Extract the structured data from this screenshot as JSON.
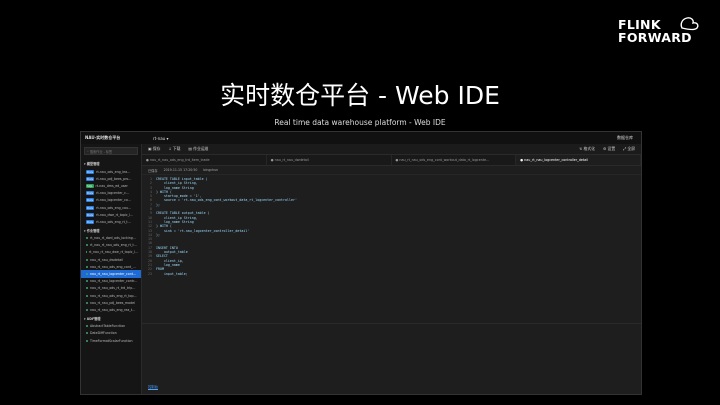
{
  "logo": {
    "line1": "FLINK",
    "line2": "FORWARD"
  },
  "title": "实时数仓平台 - Web IDE",
  "subtitle": "Real time data warehouse platform - Web IDE",
  "ide": {
    "app_name": "NAU-实时数仓平台",
    "project": "rt-nau ▾",
    "user": "数据仓库",
    "search_placeholder": "搜索作业 - 标签",
    "sections": [
      {
        "label": "▾ 模型管理",
        "items": [
          {
            "badge": "DAG",
            "label": "rt-nau_ods_eng_lea...",
            "type": "b-blue",
            "active": false
          },
          {
            "badge": "DAG",
            "label": "rt-nau_pdj_bees_pro...",
            "type": "b-blue",
            "active": false
          },
          {
            "badge": "SQL",
            "label": "rt-nau_dms_ed_user",
            "type": "b-green",
            "active": false
          },
          {
            "badge": "DAG",
            "label": "rt-nau_logcenter_c...",
            "type": "b-blue",
            "active": false
          },
          {
            "badge": "DAG",
            "label": "rt-nau_logcenter_co...",
            "type": "b-blue",
            "active": false
          },
          {
            "badge": "DAG",
            "label": "rt-nau_ods_eng_cou...",
            "type": "b-blue",
            "active": false
          },
          {
            "badge": "DAG",
            "label": "rt-nau_dwe_rt_topic_l...",
            "type": "b-blue",
            "active": false
          },
          {
            "badge": "DAG",
            "label": "rt-nau_ods_eng_rt_t...",
            "type": "b-blue",
            "active": false
          }
        ]
      },
      {
        "label": "▾ 作业管理",
        "items": [
          {
            "badge": "",
            "label": "rt_nau_rt_dwd_ods_locking...",
            "type": "",
            "active": false
          },
          {
            "badge": "",
            "label": "rt_nau_rt_nau_ods_eng_rt_t...",
            "type": "",
            "active": false
          },
          {
            "badge": "",
            "label": "rt_nau_rt_nau_dwe_rt_topic_l...",
            "type": "",
            "active": false
          },
          {
            "badge": "",
            "label": "nau_rt_nau_dwdetail",
            "type": "",
            "active": false
          },
          {
            "badge": "",
            "label": "nau_rt_nau_ods_eng_cont_...",
            "type": "",
            "active": false
          },
          {
            "badge": "",
            "label": "nau_rt_nau_logcenter_cont...",
            "type": "",
            "active": true
          },
          {
            "badge": "",
            "label": "nau_rt_nau_logcenter_contr...",
            "type": "",
            "active": false
          },
          {
            "badge": "",
            "label": "nau_rt_nau_ods_rt_trd_trip...",
            "type": "",
            "active": false
          },
          {
            "badge": "",
            "label": "nau_rt_nau_ods_eng_rt_top...",
            "type": "",
            "active": false
          },
          {
            "badge": "",
            "label": "nau_rt_nau_pdj_bees_model",
            "type": "",
            "active": false
          },
          {
            "badge": "",
            "label": "nau_rt_nau_ods_eng_rea_t...",
            "type": "",
            "active": false
          }
        ]
      },
      {
        "label": "▾ UDF管理",
        "items": [
          {
            "badge": "",
            "label": "AbstractTableFunction",
            "type": "",
            "active": false
          },
          {
            "badge": "",
            "label": "DateDiffFunction",
            "type": "",
            "active": false
          },
          {
            "badge": "",
            "label": "TimeFormatScalarFunction",
            "type": "",
            "active": false
          }
        ]
      }
    ],
    "toolbar": {
      "save": "▣ 保存",
      "download": "↓ 下载",
      "submit": "▤ 作业运维",
      "format": "↯ 格式化",
      "settings": "⚙ 设置",
      "fullscreen": "⤢ 全屏"
    },
    "tabs": [
      "● nau_rt_nau_ods_eng_trd_item_trade",
      "● nau_rt_nau_dwdetail",
      "● nau_rt_nau_ods_eng_cont_workout_data_rt_logcente...",
      "● nau_rt_nau_logcenter_controller_detail"
    ],
    "info": {
      "status": "已保存",
      "time": "2019-11-15 17:20:50",
      "owner": "bingchun"
    },
    "code": [
      "CREATE TABLE input_table (",
      "    client_ip String,",
      "    log_name String",
      ") WITH (",
      "    startup_mode = '1',",
      "    source = 'rt-nau_ods_eng_cont_workout_data_rt_logcenter_controller'",
      ");",
      "",
      "CREATE TABLE output_table (",
      "    client_ip String,",
      "    log_name String",
      ") WITH (",
      "    sink = 'rt-nau_logcenter_controller_detail'",
      ");",
      "",
      "",
      "INSERT INTO",
      "    output_table",
      "SELECT",
      "    client_ip,",
      "    log_name",
      "FROM",
      "    input_table;"
    ],
    "console_tab": "控制台"
  }
}
